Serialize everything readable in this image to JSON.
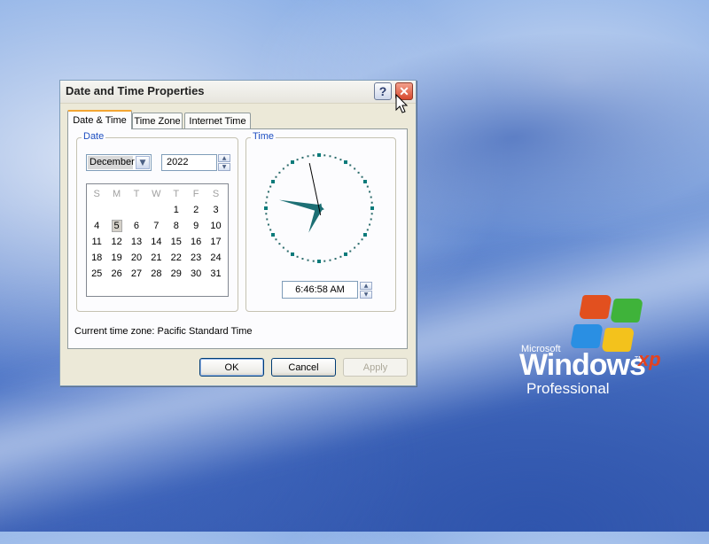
{
  "dialog": {
    "title": "Date and Time Properties",
    "help_label": "?",
    "close_label": "✕"
  },
  "tabs": [
    {
      "label": "Date & Time",
      "active": true
    },
    {
      "label": "Time Zone",
      "active": false
    },
    {
      "label": "Internet Time",
      "active": false
    }
  ],
  "date_group": {
    "label": "Date",
    "month": "December",
    "year": "2022",
    "weekday_headers": [
      "S",
      "M",
      "T",
      "W",
      "T",
      "F",
      "S"
    ],
    "days": [
      "",
      "",
      "",
      "",
      "1",
      "2",
      "3",
      "4",
      "5",
      "6",
      "7",
      "8",
      "9",
      "10",
      "11",
      "12",
      "13",
      "14",
      "15",
      "16",
      "17",
      "18",
      "19",
      "20",
      "21",
      "22",
      "23",
      "24",
      "25",
      "26",
      "27",
      "28",
      "29",
      "30",
      "31"
    ],
    "selected_day": "5"
  },
  "time_group": {
    "label": "Time",
    "time": "6:46:58 AM",
    "clock": {
      "hour": 6,
      "minute": 46,
      "second": 58
    }
  },
  "timezone": {
    "text": "Current time zone:  Pacific Standard Time"
  },
  "buttons": {
    "ok": "OK",
    "cancel": "Cancel",
    "apply": "Apply"
  },
  "logo": {
    "microsoft": "Microsoft",
    "windows": "Windows",
    "xp": "xp",
    "tm": "TM",
    "edition": "Professional"
  },
  "colors": {
    "tab_highlight": "#f3a633",
    "group_label": "#1e4fc1",
    "clock_hand": "#1d6f74"
  }
}
